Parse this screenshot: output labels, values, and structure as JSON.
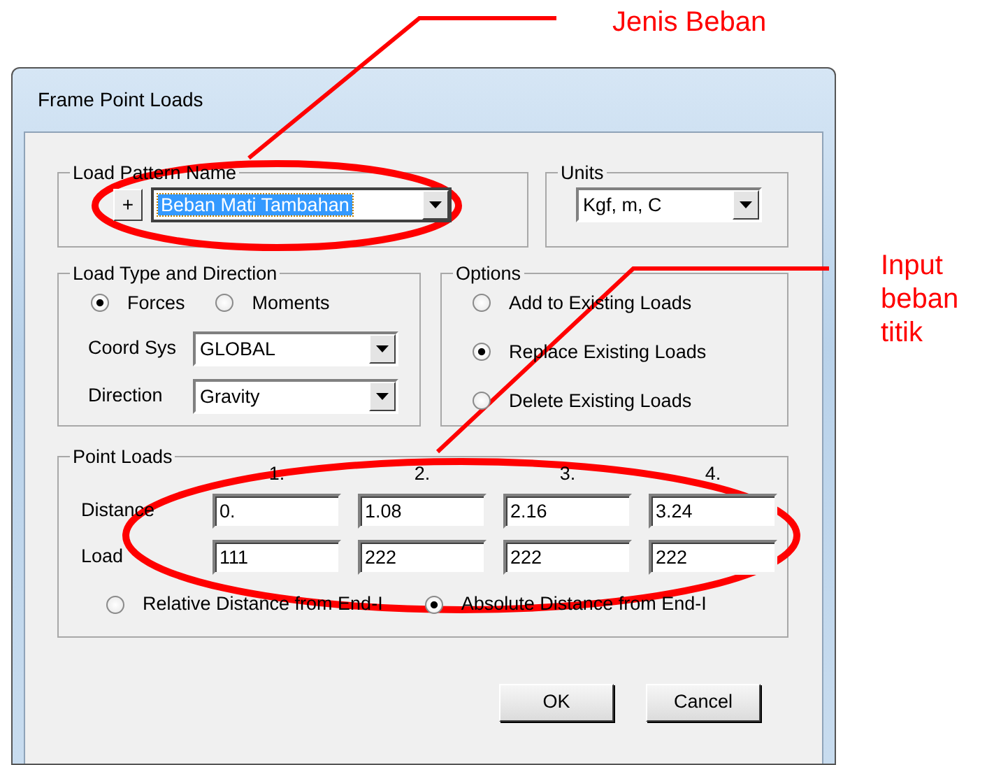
{
  "annotations": [
    {
      "lines": [
        "Jenis Beban"
      ]
    },
    {
      "lines": [
        "Input",
        "beban",
        "titik"
      ]
    }
  ],
  "window": {
    "title": "Frame Point Loads"
  },
  "load_pattern": {
    "legend": "Load Pattern Name",
    "add_button": "+",
    "value": "Beban Mati Tambahan"
  },
  "units": {
    "legend": "Units",
    "value": "Kgf, m, C"
  },
  "load_type": {
    "legend": "Load Type and Direction",
    "types": [
      {
        "label": "Forces",
        "selected": true
      },
      {
        "label": "Moments",
        "selected": false
      }
    ],
    "coord_sys": {
      "label": "Coord Sys",
      "value": "GLOBAL"
    },
    "direction": {
      "label": "Direction",
      "value": "Gravity"
    }
  },
  "options": {
    "legend": "Options",
    "items": [
      {
        "label": "Add to Existing Loads",
        "selected": false
      },
      {
        "label": "Replace Existing Loads",
        "selected": true
      },
      {
        "label": "Delete Existing Loads",
        "selected": false
      }
    ]
  },
  "point_loads": {
    "legend": "Point Loads",
    "columns": [
      "1.",
      "2.",
      "3.",
      "4."
    ],
    "rows": [
      {
        "label": "Distance",
        "values": [
          "0.",
          "1.08",
          "2.16",
          "3.24"
        ]
      },
      {
        "label": "Load",
        "values": [
          "111",
          "222",
          "222",
          "222"
        ]
      }
    ],
    "distance_modes": [
      {
        "label": "Relative Distance from End-I",
        "selected": false
      },
      {
        "label": "Absolute Distance from End-I",
        "selected": true
      }
    ]
  },
  "buttons": [
    "OK",
    "Cancel"
  ]
}
